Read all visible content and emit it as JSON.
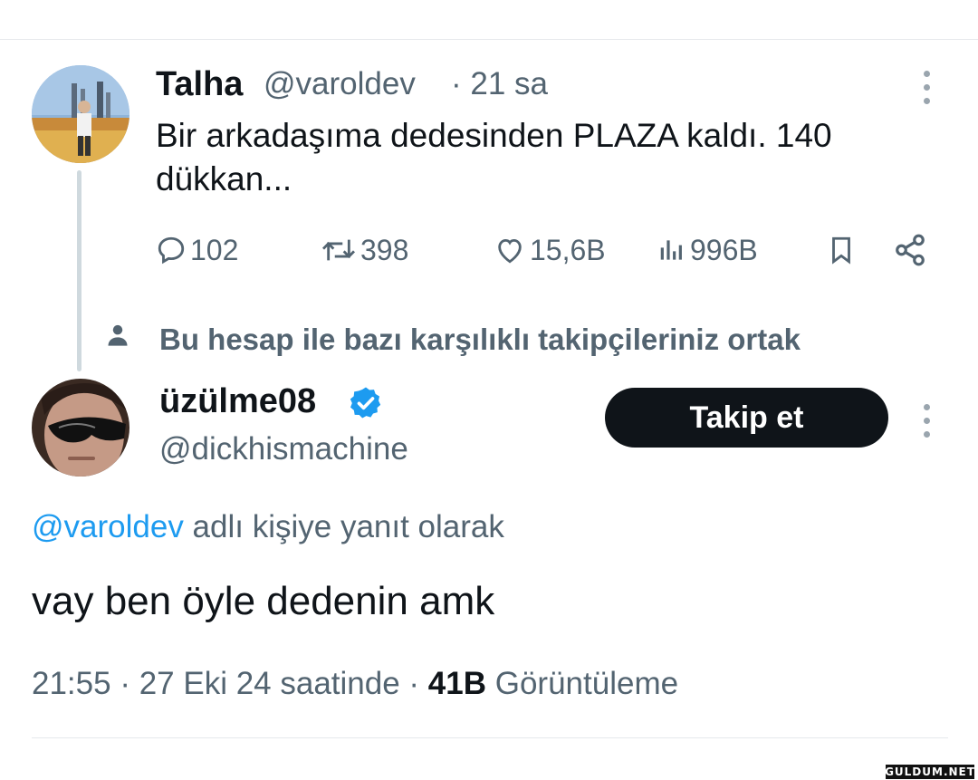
{
  "original_tweet": {
    "display_name": "Talha",
    "handle": "@varoldev",
    "time": "· 21 sa",
    "text": "Bir arkadaşıma dedesinden PLAZA kaldı. 140 dükkan...",
    "actions": {
      "replies": "102",
      "retweets": "398",
      "likes": "15,6B",
      "views": "996B"
    }
  },
  "mutual_notice": "Bu hesap ile bazı karşılıklı takipçileriniz ortak",
  "reply": {
    "display_name": "üzülme08",
    "handle": "@dickhismachine",
    "follow_label": "Takip et",
    "reply_to_handle": "@varoldev",
    "reply_to_suffix": " adlı kişiye yanıt olarak",
    "text": "vay ben öyle dedenin amk",
    "meta": {
      "time": "21:55",
      "sep1": " · ",
      "date_phrase": "27 Eki 24 saatinde",
      "sep2": " · ",
      "views_count": "41B",
      "views_label": " Görüntüleme"
    }
  },
  "watermark": "GULDUM.NET",
  "colors": {
    "accent": "#1d9bf0",
    "muted": "#536471",
    "text": "#0f1419",
    "verified": "#1d9bf0"
  }
}
